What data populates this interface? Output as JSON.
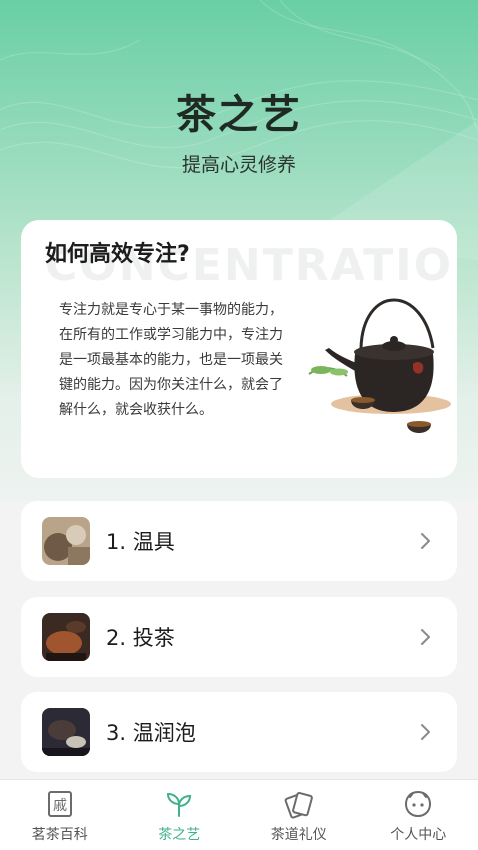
{
  "header": {
    "title": "茶之艺",
    "subtitle": "提高心灵修养"
  },
  "feature": {
    "title": "如何高效专注?",
    "watermark": "CONCENTRATION",
    "body": "专注力就是专心于某一事物的能力，在所有的工作或学习能力中，专注力是一项最基本的能力，也是一项最关键的能力。因为你关注什么，就会了解什么，就会收获什么。"
  },
  "steps": [
    {
      "label": "1. 温具"
    },
    {
      "label": "2. 投茶"
    },
    {
      "label": "3. 温润泡"
    }
  ],
  "tabbar": {
    "active_color": "#3fb28b",
    "items": [
      {
        "label": "茗茶百科",
        "icon": "book-icon"
      },
      {
        "label": "茶之艺",
        "icon": "sprout-icon",
        "active": true
      },
      {
        "label": "茶道礼仪",
        "icon": "cards-icon"
      },
      {
        "label": "个人中心",
        "icon": "face-icon"
      }
    ]
  },
  "colors": {
    "accent": "#3fb28b",
    "header_gradient_top": "#69cfa4"
  }
}
